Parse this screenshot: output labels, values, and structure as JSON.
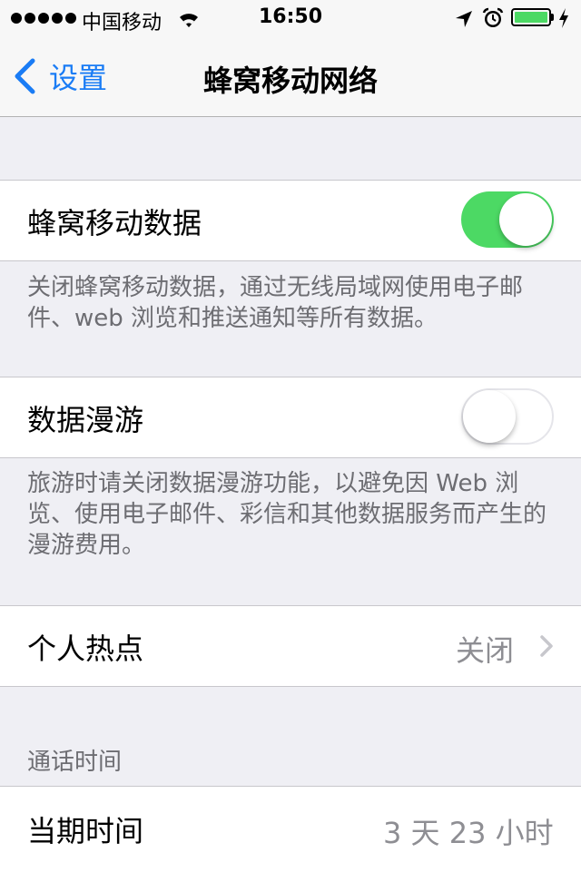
{
  "status_bar": {
    "carrier": "中国移动",
    "time": "16:50",
    "battery_level": 1.0,
    "battery_color": "#4cd964"
  },
  "nav": {
    "back_label": "设置",
    "title": "蜂窝移动网络",
    "accent_color": "#1a7cf5"
  },
  "cellular_data": {
    "label": "蜂窝移动数据",
    "enabled": true,
    "footer": "关闭蜂窝移动数据，通过无线局域网使用电子邮件、web 浏览和推送通知等所有数据。"
  },
  "data_roaming": {
    "label": "数据漫游",
    "enabled": false,
    "footer": "旅游时请关闭数据漫游功能，以避免因 Web 浏览、使用电子邮件、彩信和其他数据服务而产生的漫游费用。"
  },
  "hotspot": {
    "label": "个人热点",
    "value": "关闭"
  },
  "call_time": {
    "header": "通话时间",
    "current_period_label": "当期时间",
    "current_period_value": "3 天 23 小时"
  }
}
